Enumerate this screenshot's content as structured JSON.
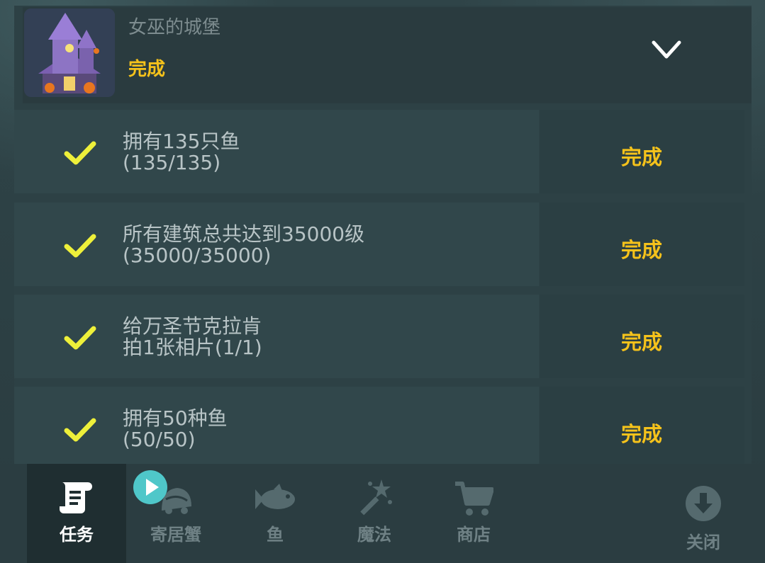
{
  "header": {
    "title": "女巫的城堡",
    "status": "完成",
    "thumbnail_icon": "haunted-castle-icon",
    "toggle_icon": "chevron-down-icon"
  },
  "tasks": [
    {
      "line1": "拥有135只鱼",
      "line2": "(135/135)",
      "status": "完成",
      "progress": 1.0
    },
    {
      "line1": "所有建筑总共达到35000级",
      "line2": "(35000/35000)",
      "status": "完成",
      "progress": 1.0
    },
    {
      "line1": "给万圣节克拉肯",
      "line2": "拍1张相片(1/1)",
      "status": "完成",
      "progress": 1.0
    },
    {
      "line1": "拥有50种鱼",
      "line2": "(50/50)",
      "status": "完成",
      "progress": 1.0
    }
  ],
  "nav": {
    "items": [
      {
        "label": "任务",
        "icon": "scroll-icon",
        "active": true
      },
      {
        "label": "寄居蟹",
        "icon": "hermit-crab-icon",
        "active": false
      },
      {
        "label": "鱼",
        "icon": "fish-icon",
        "active": false
      },
      {
        "label": "魔法",
        "icon": "magic-wand-icon",
        "active": false
      },
      {
        "label": "商店",
        "icon": "shopping-cart-icon",
        "active": false
      },
      {
        "label": "关闭",
        "icon": "download-circle-icon",
        "active": false
      }
    ],
    "badge_icon": "play-icon"
  },
  "colors": {
    "accent_yellow": "#f5c21b",
    "check_yellow": "#eef03a",
    "badge_teal": "#4fc7c9"
  }
}
